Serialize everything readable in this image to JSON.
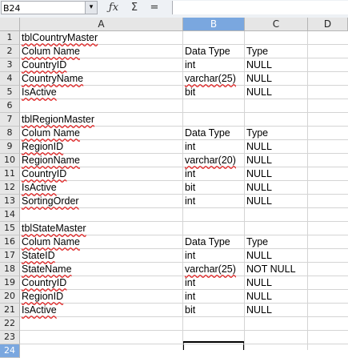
{
  "formula_bar": {
    "name_box": "B24",
    "dropdown_icon": "▾",
    "function_wizard_icon": "ƒx",
    "sum_icon": "Σ",
    "equals_icon": "=",
    "input_value": ""
  },
  "columns": [
    "A",
    "B",
    "C",
    "D"
  ],
  "selected_column": "B",
  "rows": [
    {
      "num": "1",
      "a": "tblCountryMaster",
      "b": "",
      "c": ""
    },
    {
      "num": "2",
      "a": "Colum Name",
      "b": "Data Type",
      "c": "Type"
    },
    {
      "num": "3",
      "a": "CountryID",
      "b": "int",
      "c": "NULL"
    },
    {
      "num": "4",
      "a": "CountryName",
      "b": "varchar(25)",
      "c": "NULL"
    },
    {
      "num": "5",
      "a": "IsActive",
      "b": "bit",
      "c": "NULL"
    },
    {
      "num": "6",
      "a": "",
      "b": "",
      "c": ""
    },
    {
      "num": "7",
      "a": "tblRegionMaster",
      "b": "",
      "c": ""
    },
    {
      "num": "8",
      "a": "Colum Name",
      "b": "Data Type",
      "c": "Type"
    },
    {
      "num": "9",
      "a": "RegionID",
      "b": "int",
      "c": "NULL"
    },
    {
      "num": "10",
      "a": "RegionName",
      "b": "varchar(20)",
      "c": "NULL"
    },
    {
      "num": "11",
      "a": "CountryID",
      "b": "int",
      "c": "NULL"
    },
    {
      "num": "12",
      "a": "IsActive",
      "b": "bit",
      "c": "NULL"
    },
    {
      "num": "13",
      "a": "SortingOrder",
      "b": "int",
      "c": "NULL"
    },
    {
      "num": "14",
      "a": "",
      "b": "",
      "c": ""
    },
    {
      "num": "15",
      "a": "tblStateMaster",
      "b": "",
      "c": ""
    },
    {
      "num": "16",
      "a": "Colum Name",
      "b": "Data Type",
      "c": "Type"
    },
    {
      "num": "17",
      "a": "StateID",
      "b": "int",
      "c": "NULL"
    },
    {
      "num": "18",
      "a": "StateName",
      "b": "varchar(25)",
      "c": "NOT NULL"
    },
    {
      "num": "19",
      "a": "CountryID",
      "b": "int",
      "c": "NULL"
    },
    {
      "num": "20",
      "a": "RegionID",
      "b": "int",
      "c": "NULL"
    },
    {
      "num": "21",
      "a": "IsActive",
      "b": "bit",
      "c": "NULL"
    },
    {
      "num": "22",
      "a": "",
      "b": "",
      "c": ""
    },
    {
      "num": "23",
      "a": "",
      "b": "",
      "c": ""
    },
    {
      "num": "24",
      "a": "",
      "b": "",
      "c": ""
    }
  ],
  "selected_row": "24",
  "colors": {
    "header_bg": "#e6e6e6",
    "selected_header_bg": "#7aa7df",
    "spellcheck_underline": "#e02020"
  }
}
